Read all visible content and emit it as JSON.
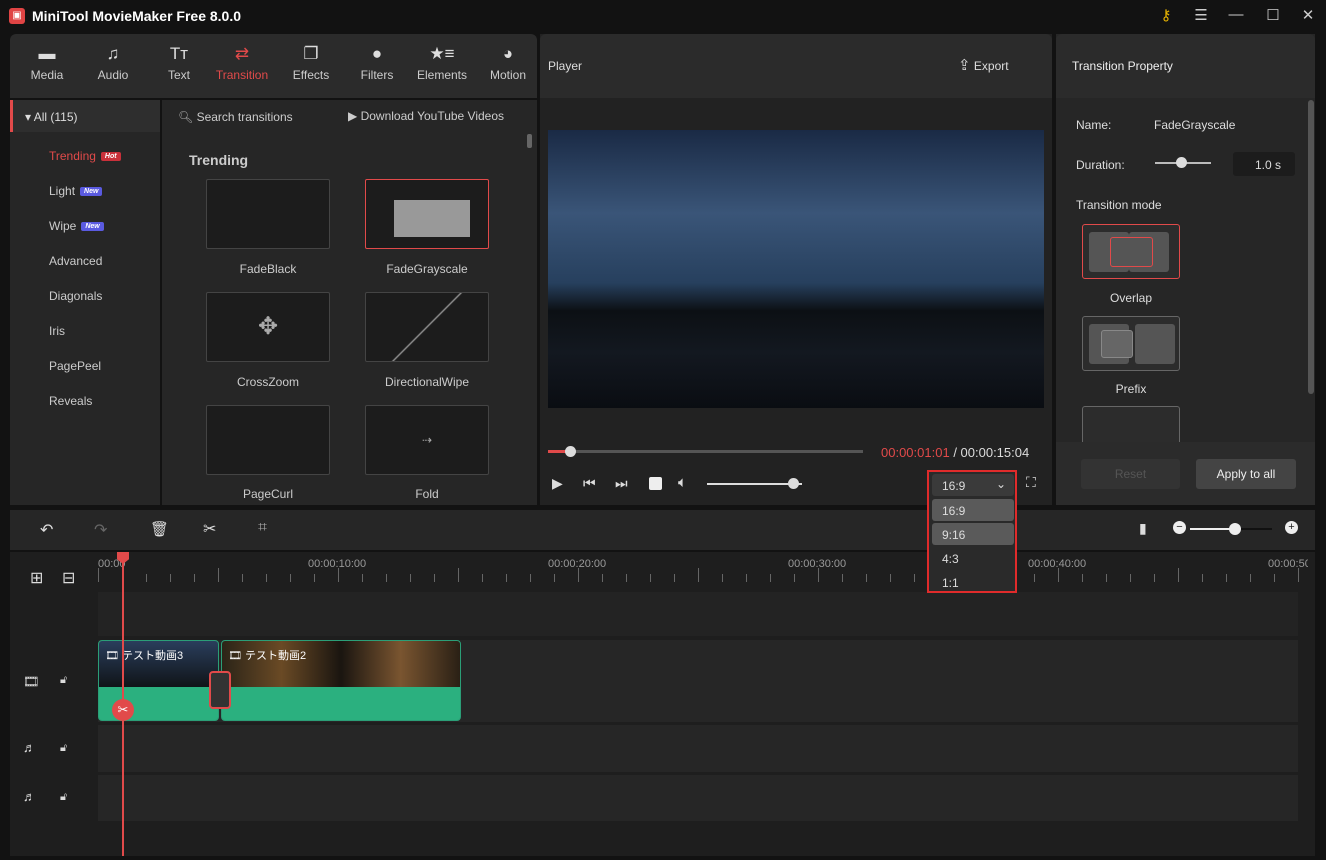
{
  "app": {
    "title": "MiniTool MovieMaker Free 8.0.0"
  },
  "toolbar": [
    {
      "label": "Media",
      "icon": "folder-icon"
    },
    {
      "label": "Audio",
      "icon": "music-icon"
    },
    {
      "label": "Text",
      "icon": "text-icon"
    },
    {
      "label": "Transition",
      "icon": "transition-icon",
      "active": true
    },
    {
      "label": "Effects",
      "icon": "effects-icon"
    },
    {
      "label": "Filters",
      "icon": "filters-icon"
    },
    {
      "label": "Elements",
      "icon": "elements-icon"
    },
    {
      "label": "Motion",
      "icon": "motion-icon"
    }
  ],
  "categories": {
    "all": "All (115)",
    "items": [
      {
        "label": "Trending",
        "badge": "Hot",
        "active": true
      },
      {
        "label": "Light",
        "badge": "New"
      },
      {
        "label": "Wipe",
        "badge": "New"
      },
      {
        "label": "Advanced"
      },
      {
        "label": "Diagonals"
      },
      {
        "label": "Iris"
      },
      {
        "label": "PagePeel"
      },
      {
        "label": "Reveals"
      }
    ]
  },
  "content": {
    "search_placeholder": "Search transitions",
    "download": "Download YouTube Videos",
    "section": "Trending",
    "items": [
      "FadeBlack",
      "FadeGrayscale",
      "CrossZoom",
      "DirectionalWipe",
      "PageCurl",
      "Fold"
    ]
  },
  "player": {
    "title": "Player",
    "export": "Export",
    "current_time": "00:00:01:01",
    "total_time": "/ 00:00:15:04",
    "progress": 0.07,
    "volume": 0.8,
    "aspect_ratio": "16:9",
    "ratio_options": [
      "16:9",
      "9:16",
      "4:3",
      "1:1"
    ]
  },
  "property": {
    "title": "Transition Property",
    "name_label": "Name:",
    "name_value": "FadeGrayscale",
    "duration_label": "Duration:",
    "duration_value": "1.0 s",
    "mode_label": "Transition mode",
    "modes": [
      "Overlap",
      "Prefix"
    ],
    "reset": "Reset",
    "apply_all": "Apply to all"
  },
  "timeline": {
    "ruler": [
      "00:00",
      "00:00:10:00",
      "00:00:20:00",
      "00:00:30:00",
      "00:00:40:00",
      "00:00:50:00"
    ],
    "clips": [
      "テスト動画3",
      "テスト動画2"
    ],
    "zoom": 0.55
  },
  "colors": {
    "accent": "#e14a4a",
    "clip": "#2bb07f"
  }
}
